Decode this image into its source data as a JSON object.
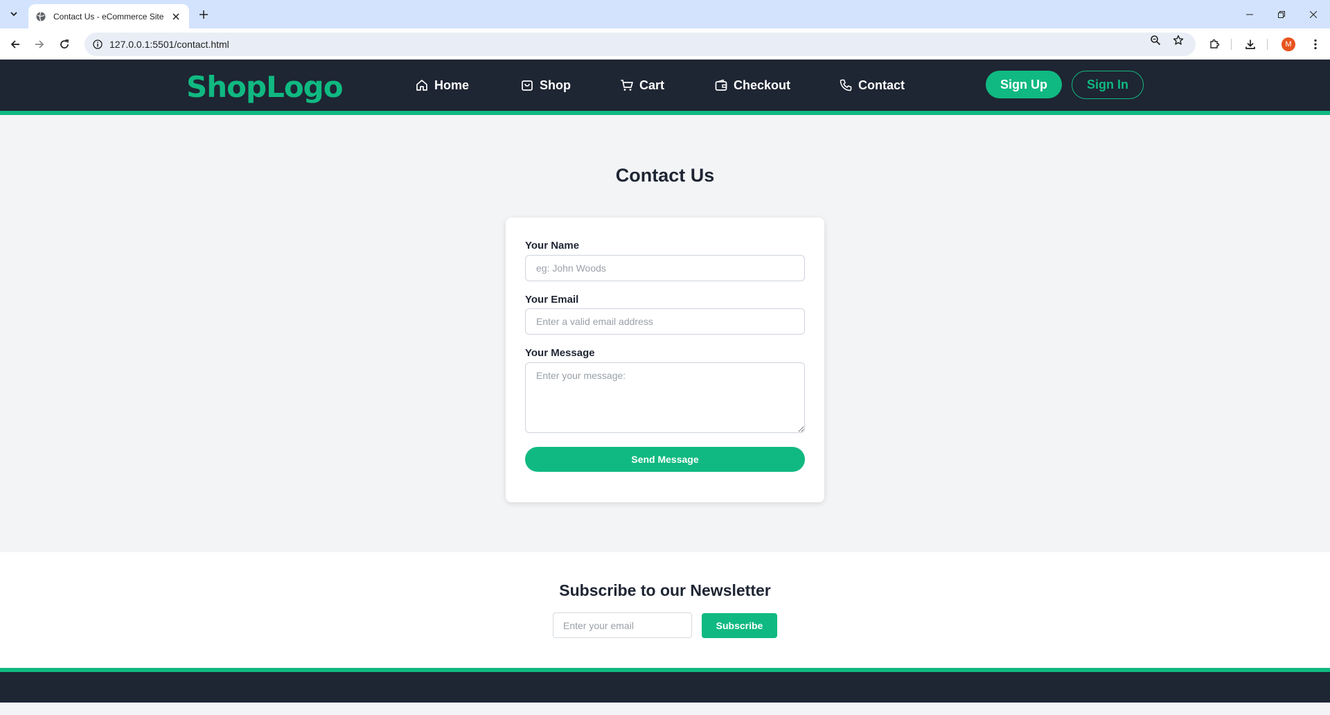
{
  "browser": {
    "tab_title": "Contact Us - eCommerce Site",
    "url": "127.0.0.1:5501/contact.html",
    "profile_initial": "M"
  },
  "header": {
    "logo": "ShopLogo",
    "nav": [
      {
        "label": "Home",
        "icon": "home-icon"
      },
      {
        "label": "Shop",
        "icon": "bag-icon"
      },
      {
        "label": "Cart",
        "icon": "cart-icon"
      },
      {
        "label": "Checkout",
        "icon": "wallet-icon"
      },
      {
        "label": "Contact",
        "icon": "phone-icon"
      }
    ],
    "signup_label": "Sign Up",
    "signin_label": "Sign In"
  },
  "contact": {
    "title": "Contact Us",
    "name_label": "Your Name",
    "name_placeholder": "eg: John Woods",
    "email_label": "Your Email",
    "email_placeholder": "Enter a valid email address",
    "message_label": "Your Message",
    "message_placeholder": "Enter your message:",
    "send_label": "Send Message"
  },
  "newsletter": {
    "title": "Subscribe to our Newsletter",
    "email_placeholder": "Enter your email",
    "subscribe_label": "Subscribe"
  },
  "colors": {
    "accent": "#10b981",
    "header_bg": "#1e2533",
    "page_bg": "#f3f4f6"
  }
}
